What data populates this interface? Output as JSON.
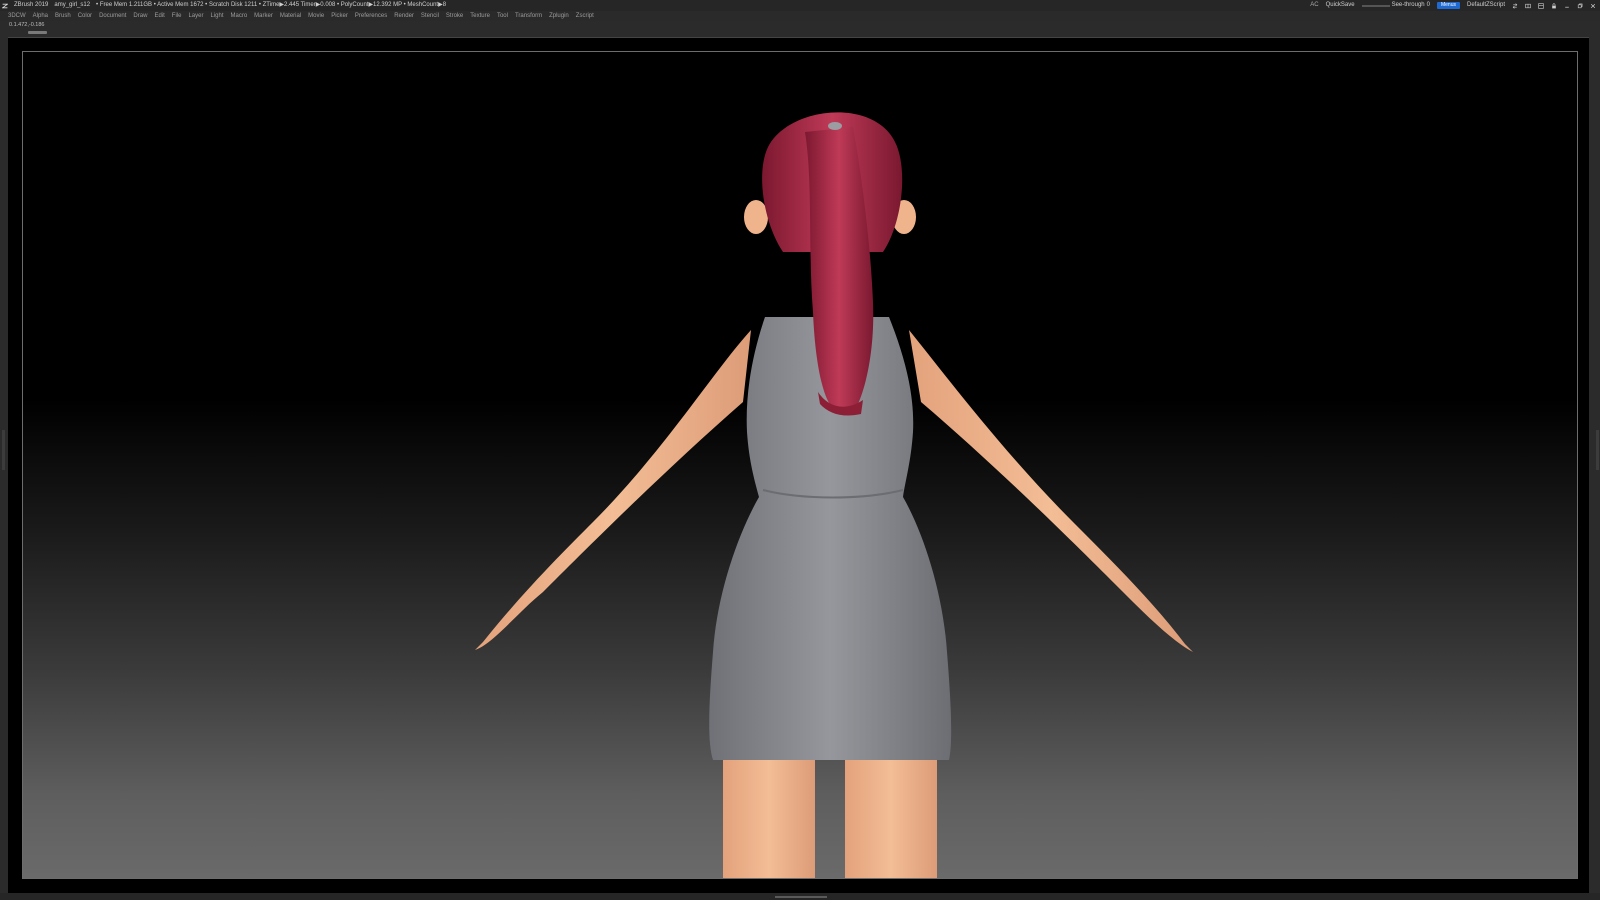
{
  "titlebar": {
    "app": "ZBrush 2019",
    "file": "amy_girl_s12",
    "stats": "• Free Mem 1.211GB • Active Mem 1672 • Scratch Disk 1211 • ZTime▶2.445 Timer▶0.008 • PolyCount▶12.392 MP • MeshCount▶8",
    "ac": "AC",
    "quicksave": "QuickSave",
    "see_through_label": "See-through",
    "see_through_value": 0,
    "menus": "Menus",
    "script": "DefaultZScript"
  },
  "menubar": {
    "items": [
      "3DCW",
      "Alpha",
      "Brush",
      "Color",
      "Document",
      "Draw",
      "Edit",
      "File",
      "Layer",
      "Light",
      "Macro",
      "Marker",
      "Material",
      "Movie",
      "Picker",
      "Preferences",
      "Render",
      "Stencil",
      "Stroke",
      "Texture",
      "Tool",
      "Transform",
      "Zplugin",
      "Zscript"
    ]
  },
  "status": {
    "coords": "0.1.472,-0.186"
  },
  "colors": {
    "hair": "#b0304a",
    "skin": "#f0b48c",
    "dress": "#8a8c91",
    "accent": "#1e6ad0",
    "slider": "#d88a2a"
  }
}
